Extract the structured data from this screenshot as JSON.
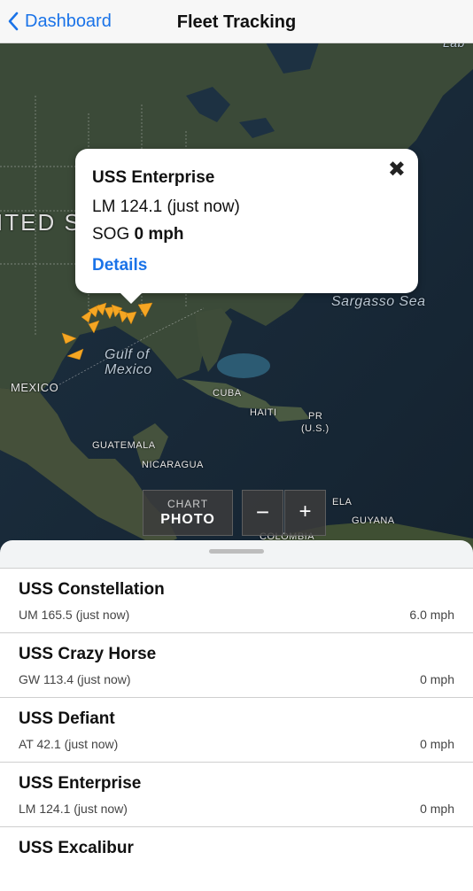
{
  "nav": {
    "back_label": "Dashboard",
    "title": "Fleet Tracking"
  },
  "map": {
    "labels": {
      "country_fragment": "ITED S",
      "mexico": "MEXICO",
      "gulf_line1": "Gulf of",
      "gulf_line2": "Mexico",
      "sargasso": "Sargasso Sea",
      "cuba": "CUBA",
      "haiti": "HAITI",
      "pr_line1": "PR",
      "pr_line2": "(U.S.)",
      "guatemala": "GUATEMALA",
      "nicaragua": "NICARAGUA",
      "guyana": "GUYANA",
      "ela": "ELA",
      "colombia": "COLOMBIA",
      "top_right": "Lab"
    },
    "marker_color": "#f5a623",
    "mode_top": "CHART",
    "mode_bottom": "PHOTO",
    "zoom_out_label": "−",
    "zoom_in_label": "+"
  },
  "callout": {
    "name": "USS Enterprise",
    "location": "LM 124.1 (just now)",
    "sog_label": "SOG",
    "sog_value": "0 mph",
    "details_label": "Details",
    "close_icon": "close-icon"
  },
  "vessels": [
    {
      "name": "USS Constellation",
      "location": "UM 165.5 (just now)",
      "speed": "6.0 mph"
    },
    {
      "name": "USS Crazy Horse",
      "location": "GW 113.4 (just now)",
      "speed": "0 mph"
    },
    {
      "name": "USS Defiant",
      "location": "AT 42.1 (just now)",
      "speed": "0 mph"
    },
    {
      "name": "USS Enterprise",
      "location": "LM 124.1 (just now)",
      "speed": "0 mph"
    },
    {
      "name": "USS Excalibur",
      "location": "",
      "speed": ""
    }
  ],
  "colors": {
    "accent": "#1a73e8",
    "ocean": "#1b2b3a",
    "land": "#3a4a3e"
  }
}
